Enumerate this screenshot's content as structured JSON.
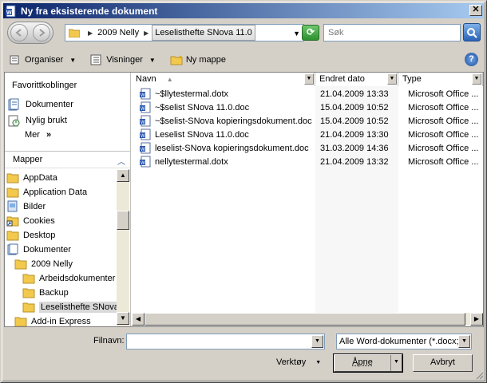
{
  "window": {
    "title": "Ny fra eksisterende dokument",
    "close_glyph": "✕"
  },
  "address": {
    "breadcrumbs": [
      "2009 Nelly",
      "Leselisthefte SNova 11.0"
    ],
    "search_placeholder": "Søk"
  },
  "toolbar": {
    "organize_label": "Organiser",
    "views_label": "Visninger",
    "new_folder_label": "Ny mappe",
    "help_glyph": "?"
  },
  "favorites": {
    "title": "Favorittkoblinger",
    "items": [
      {
        "label": "Dokumenter",
        "icon": "documents-icon"
      },
      {
        "label": "Nylig brukt",
        "icon": "recent-icon"
      }
    ],
    "more_label": "Mer",
    "more_glyph": "»"
  },
  "folders": {
    "header": "Mapper",
    "items": [
      {
        "label": "AppData",
        "indent": 0
      },
      {
        "label": "Application Data",
        "indent": 0
      },
      {
        "label": "Bilder",
        "indent": 0
      },
      {
        "label": "Cookies",
        "indent": 0
      },
      {
        "label": "Desktop",
        "indent": 0
      },
      {
        "label": "Dokumenter",
        "indent": 0
      },
      {
        "label": "2009 Nelly",
        "indent": 1
      },
      {
        "label": "Arbeidsdokumenter",
        "indent": 2
      },
      {
        "label": "Backup",
        "indent": 2
      },
      {
        "label": "Leselisthefte SNova",
        "indent": 2,
        "selected": true
      },
      {
        "label": "Add-in Express",
        "indent": 0
      }
    ]
  },
  "columns": {
    "name": "Navn",
    "date": "Endret dato",
    "type": "Type"
  },
  "files": [
    {
      "name": "~$llytestermal.dotx",
      "date": "21.04.2009 13:33",
      "type": "Microsoft Office ..."
    },
    {
      "name": "~$selist SNova 11.0.doc",
      "date": "15.04.2009 10:52",
      "type": "Microsoft Office ..."
    },
    {
      "name": "~$selist-SNova kopieringsdokument.doc",
      "date": "15.04.2009 10:52",
      "type": "Microsoft Office ..."
    },
    {
      "name": "Leselist SNova 11.0.doc",
      "date": "21.04.2009 13:30",
      "type": "Microsoft Office ..."
    },
    {
      "name": "leselist-SNova kopieringsdokument.doc",
      "date": "31.03.2009 14:36",
      "type": "Microsoft Office ..."
    },
    {
      "name": "nellytestermal.dotx",
      "date": "21.04.2009 13:32",
      "type": "Microsoft Office ..."
    }
  ],
  "form": {
    "filename_label": "Filnavn:",
    "filename_value": "",
    "filter_value": "Alle Word-dokumenter (*.docx;*",
    "tools_label": "Verktøy",
    "open_label": "Åpne",
    "cancel_label": "Avbryt"
  },
  "colors": {
    "title_gradient_start": "#0a246a",
    "title_gradient_end": "#a6caf0",
    "face": "#d4d0c8"
  }
}
